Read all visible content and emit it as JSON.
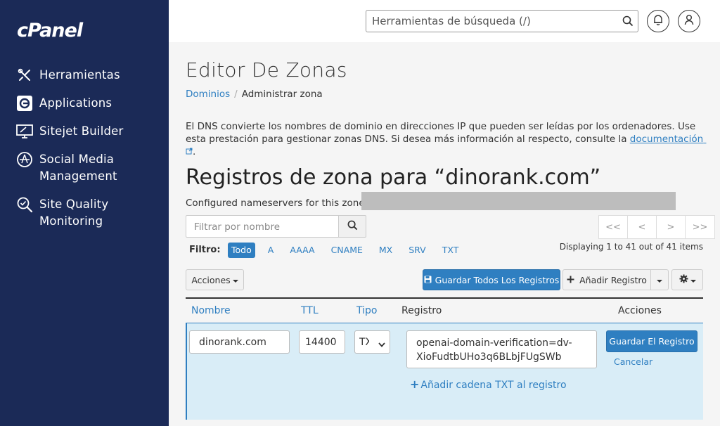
{
  "brand": {
    "logo": "cPanel"
  },
  "sidebar": {
    "items": [
      {
        "label": "Herramientas",
        "icon": "tools-icon"
      },
      {
        "label": "Applications",
        "icon": "applications-icon"
      },
      {
        "label": "Sitejet Builder",
        "icon": "sitejet-icon"
      },
      {
        "label_line1": "Social Media",
        "label_line2": "Management",
        "icon": "social-media-icon"
      },
      {
        "label_line1": "Site Quality",
        "label_line2": "Monitoring",
        "icon": "site-quality-icon"
      }
    ]
  },
  "topbar": {
    "search_placeholder": "Herramientas de búsqueda (/)"
  },
  "page": {
    "title": "Editor De Zonas",
    "breadcrumb": {
      "parent": "Dominios",
      "current": "Administrar zona"
    },
    "description_text": "El DNS convierte los nombres de dominio en direcciones IP que pueden ser leídas por los ordenadores. Use esta prestación para gestionar zonas DNS. Si desea más información al respecto, consulte la ",
    "description_link": "documentación",
    "description_end": ".",
    "zone_title": "Registros de zona para “dinorank.com”",
    "nameservers_label": "Configured nameservers for this zone:"
  },
  "filter": {
    "placeholder": "Filtrar por nombre",
    "label": "Filtro:",
    "tabs": [
      "Todo",
      "A",
      "AAAA",
      "CNAME",
      "MX",
      "SRV",
      "TXT"
    ],
    "active": "Todo"
  },
  "pagination": {
    "buttons": [
      "<<",
      "<",
      ">",
      ">>"
    ],
    "info": "Displaying 1 to 41 out of 41 items"
  },
  "toolbar": {
    "actions_label": "Acciones",
    "save_all_label": "Guardar Todos Los Registros",
    "add_record_label": "Añadir Registro"
  },
  "table": {
    "headers": {
      "name": "Nombre",
      "ttl": "TTL",
      "type": "Tipo",
      "record": "Registro",
      "actions": "Acciones"
    },
    "edit_row": {
      "name": "dinorank.com",
      "ttl": "14400",
      "type": "TXT",
      "record_line1": "openai-domain-verification=dv-",
      "record_line2": "XioFudtbUHo3q6BLbjFUgSWb",
      "save_label": "Guardar El Registro",
      "cancel_label": "Cancelar",
      "add_txt_label": "Añadir cadena TXT al registro"
    }
  },
  "colors": {
    "sidebar_bg": "#1b2a57",
    "accent": "#2f7fc1",
    "edit_row_bg": "#d9edf7"
  }
}
